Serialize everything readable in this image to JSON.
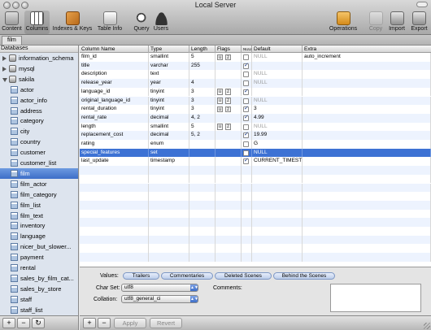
{
  "window": {
    "title": "Local Server"
  },
  "toolbar": {
    "left": [
      {
        "label": "Content",
        "icon": "content-icon"
      },
      {
        "label": "Columns",
        "icon": "columns-icon",
        "selected": true
      },
      {
        "label": "Indexes & Keys",
        "icon": "indexes-icon"
      },
      {
        "label": "Table Info",
        "icon": "table-info-icon"
      },
      {
        "label": "Query",
        "icon": "query-icon"
      },
      {
        "label": "Users",
        "icon": "users-icon"
      }
    ],
    "right": [
      {
        "label": "Operations",
        "icon": "operations-icon"
      },
      {
        "label": "Copy",
        "icon": "copy-icon",
        "disabled": true
      },
      {
        "label": "Import",
        "icon": "import-icon"
      },
      {
        "label": "Export",
        "icon": "export-icon"
      }
    ]
  },
  "tab": {
    "label": "film"
  },
  "sidebar": {
    "header": "Databases",
    "items": [
      {
        "label": "information_schema",
        "kind": "db"
      },
      {
        "label": "mysql",
        "kind": "db"
      },
      {
        "label": "sakila",
        "kind": "db",
        "open": true
      },
      {
        "label": "actor",
        "kind": "table"
      },
      {
        "label": "actor_info",
        "kind": "table"
      },
      {
        "label": "address",
        "kind": "table"
      },
      {
        "label": "category",
        "kind": "table"
      },
      {
        "label": "city",
        "kind": "table"
      },
      {
        "label": "country",
        "kind": "table"
      },
      {
        "label": "customer",
        "kind": "table"
      },
      {
        "label": "customer_list",
        "kind": "table"
      },
      {
        "label": "film",
        "kind": "table",
        "selected": true
      },
      {
        "label": "film_actor",
        "kind": "table"
      },
      {
        "label": "film_category",
        "kind": "table"
      },
      {
        "label": "film_list",
        "kind": "table"
      },
      {
        "label": "film_text",
        "kind": "table"
      },
      {
        "label": "inventory",
        "kind": "table"
      },
      {
        "label": "language",
        "kind": "table"
      },
      {
        "label": "nicer_but_slower...",
        "kind": "table"
      },
      {
        "label": "payment",
        "kind": "table"
      },
      {
        "label": "rental",
        "kind": "table"
      },
      {
        "label": "sales_by_film_cat...",
        "kind": "table"
      },
      {
        "label": "sales_by_store",
        "kind": "table"
      },
      {
        "label": "staff",
        "kind": "table"
      },
      {
        "label": "staff_list",
        "kind": "table"
      }
    ],
    "bottom_buttons": [
      "+",
      "−",
      "↻"
    ]
  },
  "grid": {
    "headers": {
      "column_name": "Column Name",
      "type": "Type",
      "length": "Length",
      "flags": "Flags",
      "null_header": "NULL",
      "default": "Default",
      "extra": "Extra"
    },
    "rows": [
      {
        "name": "film_id",
        "type": "smallint",
        "length": "5",
        "flags": [
          "u",
          "z"
        ],
        "null": false,
        "default": "NULL",
        "default_null": true,
        "extra": "auto_increment"
      },
      {
        "name": "title",
        "type": "varchar",
        "length": "255",
        "flags": [],
        "null": true,
        "default": "",
        "default_null": false,
        "extra": ""
      },
      {
        "name": "description",
        "type": "text",
        "length": "",
        "flags": [],
        "null": false,
        "default": "NULL",
        "default_null": true,
        "extra": ""
      },
      {
        "name": "release_year",
        "type": "year",
        "length": "4",
        "flags": [],
        "null": false,
        "default": "NULL",
        "default_null": true,
        "extra": ""
      },
      {
        "name": "language_id",
        "type": "tinyint",
        "length": "3",
        "flags": [
          "u",
          "z"
        ],
        "null": true,
        "default": "",
        "default_null": false,
        "extra": ""
      },
      {
        "name": "original_language_id",
        "type": "tinyint",
        "length": "3",
        "flags": [
          "u",
          "z"
        ],
        "null": false,
        "default": "NULL",
        "default_null": true,
        "extra": ""
      },
      {
        "name": "rental_duration",
        "type": "tinyint",
        "length": "3",
        "flags": [
          "u",
          "z"
        ],
        "null": true,
        "default": "3",
        "default_null": false,
        "extra": ""
      },
      {
        "name": "rental_rate",
        "type": "decimal",
        "length": "4, 2",
        "flags": [],
        "null": true,
        "default": "4.99",
        "default_null": false,
        "extra": ""
      },
      {
        "name": "length",
        "type": "smallint",
        "length": "5",
        "flags": [
          "u",
          "z"
        ],
        "null": false,
        "default": "NULL",
        "default_null": true,
        "extra": ""
      },
      {
        "name": "replacement_cost",
        "type": "decimal",
        "length": "5, 2",
        "flags": [],
        "null": true,
        "default": "19.99",
        "default_null": false,
        "extra": ""
      },
      {
        "name": "rating",
        "type": "enum",
        "length": "",
        "flags": [],
        "null": false,
        "default": "G",
        "default_null": false,
        "extra": ""
      },
      {
        "name": "special_features",
        "type": "set",
        "length": "",
        "flags": [],
        "null": false,
        "default": "NULL",
        "default_null": true,
        "extra": "",
        "selected": true
      },
      {
        "name": "last_update",
        "type": "timestamp",
        "length": "",
        "flags": [],
        "null": true,
        "default": "CURRENT_TIMEST",
        "default_null": false,
        "extra": ""
      }
    ]
  },
  "editor": {
    "values_label": "Values:",
    "values": [
      "Trailers",
      "Commentaries",
      "Deleted Scenes",
      "Behind the Scenes"
    ],
    "charset_label": "Char Set:",
    "charset_value": "utf8",
    "collation_label": "Collation:",
    "collation_value": "utf8_general_ci",
    "comments_label": "Comments:"
  },
  "bottombar": {
    "add": "+",
    "remove": "−",
    "apply": "Apply",
    "revert": "Revert"
  }
}
